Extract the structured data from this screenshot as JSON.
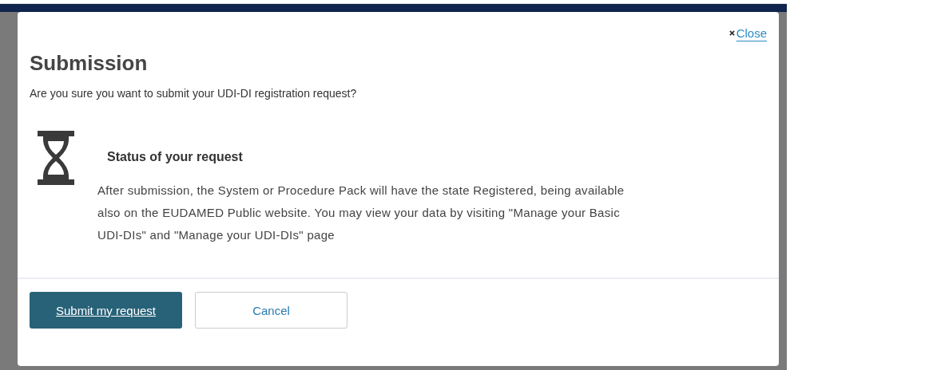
{
  "dialog": {
    "title": "Submission",
    "close_label": "Close",
    "question": "Are you sure you want to submit your UDI-DI registration request?",
    "status": {
      "heading": "Status of your request",
      "text": "After submission, the System or Procedure Pack will have the state Registered, being available also on the EUDAMED Public website. You may view your data by visiting \"Manage your Basic UDI-DIs\" and \"Manage your UDI-DIs\" page"
    },
    "buttons": [
      {
        "label": "Submit my request",
        "kind": "primary"
      },
      {
        "label": "Cancel",
        "kind": "secondary"
      }
    ]
  }
}
